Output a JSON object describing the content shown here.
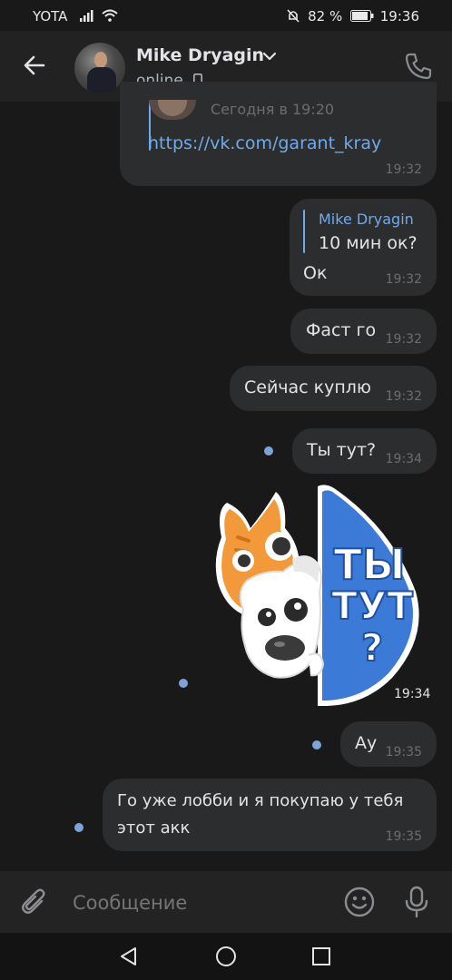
{
  "status": {
    "carrier": "YOTA",
    "battery": "82 %",
    "time": "19:36"
  },
  "header": {
    "name": "Mike Dryagin",
    "status": "online"
  },
  "messages": [
    {
      "id": "m0",
      "link_meta": "Сегодня в 19:20",
      "link": "https://vk.com/garant_kray",
      "time": "19:32"
    },
    {
      "id": "m1",
      "reply_name": "Mike Dryagin",
      "reply_text": "10 мин ок?",
      "text": "Ок",
      "time": "19:32"
    },
    {
      "id": "m2",
      "text": "Фаст го",
      "time": "19:32"
    },
    {
      "id": "m3",
      "text": "Сейчас куплю",
      "time": "19:32"
    },
    {
      "id": "m4",
      "text": "Ты тут?",
      "time": "19:34"
    },
    {
      "id": "m5",
      "sticker_text_1": "ТЫ",
      "sticker_text_2": "ТУТ",
      "sticker_text_3": "?",
      "time": "19:34"
    },
    {
      "id": "m6",
      "text": "Ау",
      "time": "19:35"
    },
    {
      "id": "m7",
      "text_line1": "Го уже лобби и я покупаю у тебя",
      "text_line2": "этот акк",
      "time": "19:35"
    }
  ],
  "composer": {
    "placeholder": "Сообщение"
  }
}
